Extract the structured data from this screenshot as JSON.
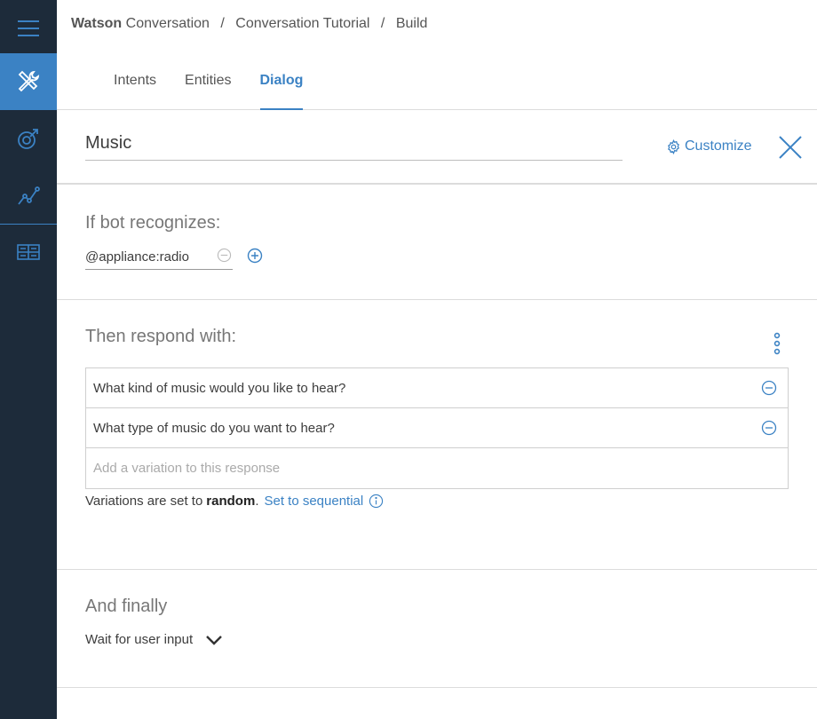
{
  "header": {
    "brand_strong": "Watson",
    "brand_rest": "Conversation",
    "crumb_workspace": "Conversation Tutorial",
    "crumb_page": "Build",
    "separator": "/"
  },
  "tabs": [
    {
      "label": "Intents",
      "active": false
    },
    {
      "label": "Entities",
      "active": false
    },
    {
      "label": "Dialog",
      "active": true
    }
  ],
  "node": {
    "name": "Music",
    "customize_label": "Customize"
  },
  "condition": {
    "heading": "If bot recognizes:",
    "value": "@appliance:radio"
  },
  "response": {
    "heading": "Then respond with:",
    "variations": [
      "What kind of music would you like to hear?",
      "What type of music do you want to hear?"
    ],
    "add_placeholder": "Add a variation to this response",
    "mode_prefix": "Variations are set to",
    "mode_value": "random",
    "mode_suffix": ".",
    "mode_link": "Set to sequential"
  },
  "finally": {
    "heading": "And finally",
    "action": "Wait for user input"
  },
  "icons": {
    "menu": "hamburger-icon",
    "build": "tools-icon",
    "improve": "target-icon",
    "analytics": "line-chart-icon",
    "deploy": "grid-icon",
    "customize": "gear-icon",
    "close": "close-icon",
    "remove": "minus-circle-icon",
    "add": "plus-circle-icon",
    "more": "kebab-icon",
    "info": "info-icon",
    "dropdown": "chevron-down-icon"
  },
  "colors": {
    "accent": "#3b82c4",
    "rail": "#1d2b3a"
  }
}
